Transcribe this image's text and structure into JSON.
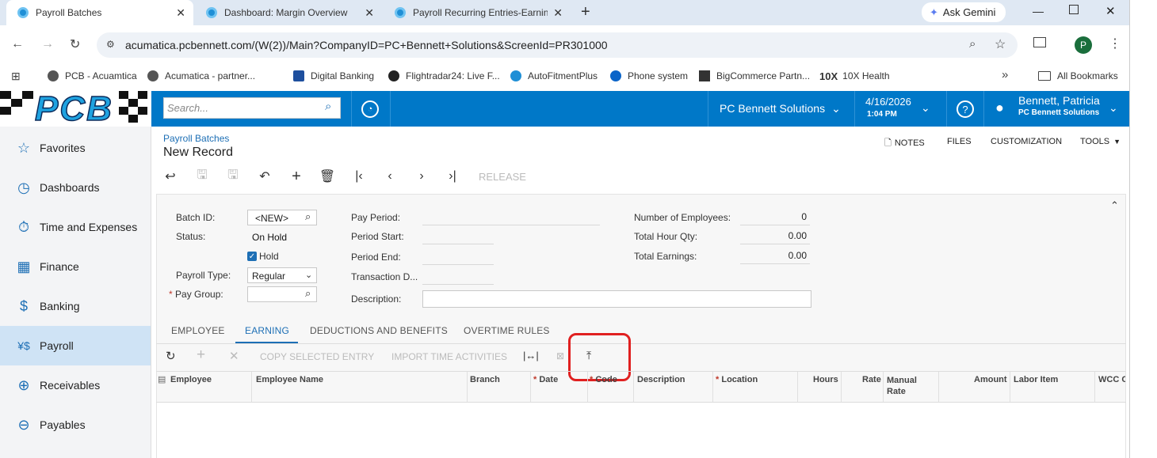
{
  "browser": {
    "tabs": [
      {
        "title": "Payroll Batches",
        "active": true
      },
      {
        "title": "Dashboard: Margin Overview",
        "active": false
      },
      {
        "title": "Payroll Recurring Entries-Earnin",
        "active": false
      }
    ],
    "new_tab": "+",
    "gemini": "Ask Gemini",
    "url": "acumatica.pcbennett.com/(W(2))/Main?CompanyID=PC+Bennett+Solutions&ScreenId=PR301000",
    "profile_initial": "P",
    "bookmarks": [
      "PCB - Acuamtica",
      "Acumatica - partner...",
      "Digital Banking",
      "Flightradar24: Live F...",
      "AutoFitmentPlus",
      "Phone system",
      "BigCommerce Partn...",
      "10X Health"
    ],
    "all_bookmarks": "All Bookmarks",
    "more": "»"
  },
  "header": {
    "logo": "PCB",
    "search_placeholder": "Search...",
    "company": "PC Bennett Solutions",
    "date": "4/16/2026",
    "time": "1:04 PM",
    "help": "?",
    "user_name": "Bennett, Patricia",
    "user_company": "PC Bennett Solutions"
  },
  "sidebar": {
    "items": [
      {
        "label": "Favorites",
        "icon": "☆"
      },
      {
        "label": "Dashboards",
        "icon": "◷"
      },
      {
        "label": "Time and Expenses",
        "icon": "⏱"
      },
      {
        "label": "Finance",
        "icon": "▦"
      },
      {
        "label": "Banking",
        "icon": "$"
      },
      {
        "label": "Payroll",
        "icon": "¥$"
      },
      {
        "label": "Receivables",
        "icon": "⊕"
      },
      {
        "label": "Payables",
        "icon": "⊖"
      }
    ]
  },
  "page": {
    "breadcrumb": "Payroll Batches",
    "title": "New Record",
    "top_actions": {
      "notes": "NOTES",
      "files": "FILES",
      "customization": "CUSTOMIZATION",
      "tools": "TOOLS"
    },
    "release": "RELEASE"
  },
  "form": {
    "batch_id_label": "Batch ID:",
    "batch_id": "<NEW>",
    "status_label": "Status:",
    "status": "On Hold",
    "hold_label": "Hold",
    "payroll_type_label": "Payroll Type:",
    "payroll_type": "Regular",
    "pay_group_label": "Pay Group:",
    "pay_period_label": "Pay Period:",
    "period_start_label": "Period Start:",
    "period_end_label": "Period End:",
    "transaction_label": "Transaction D...",
    "description_label": "Description:",
    "num_employees_label": "Number of Employees:",
    "num_employees": "0",
    "total_hour_label": "Total Hour Qty:",
    "total_hour": "0.00",
    "total_earnings_label": "Total Earnings:",
    "total_earnings": "0.00"
  },
  "detail_tabs": [
    "EMPLOYEE",
    "EARNING",
    "DEDUCTIONS AND BENEFITS",
    "OVERTIME RULES"
  ],
  "grid_toolbar": {
    "copy": "COPY SELECTED ENTRY",
    "import": "IMPORT TIME ACTIVITIES"
  },
  "grid_columns": [
    "Employee",
    "Employee Name",
    "Branch",
    "Date",
    "Code",
    "Description",
    "Location",
    "Hours",
    "Rate",
    "Manual Rate",
    "Amount",
    "Labor Item",
    "WCC C"
  ],
  "colors": {
    "brand": "#0078c8",
    "highlight": "#e02020"
  }
}
